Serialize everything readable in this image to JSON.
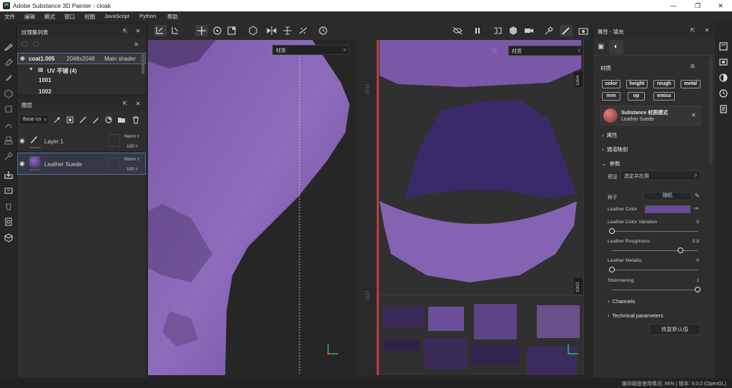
{
  "window": {
    "title": "Adobe Substance 3D Painter - cloak",
    "logo_text": "Pt"
  },
  "menu": [
    "文件",
    "编辑",
    "模式",
    "窗口",
    "视图",
    "JavaScript",
    "Python",
    "帮助"
  ],
  "texture_set_panel": {
    "title": "纹理集列表",
    "set_name": "coat1.005",
    "resolution": "2048x2048",
    "shader": "Main shader",
    "uv_group": "UV 平铺 (4)",
    "tiles": [
      "1001",
      "1002"
    ]
  },
  "layer_panel": {
    "title": "图层",
    "channel_select": "Base co",
    "layers": [
      {
        "name": "Layer 1",
        "blend": "Norm",
        "opacity": "100"
      },
      {
        "name": "Leather Suede",
        "blend": "Norm",
        "opacity": "100"
      }
    ]
  },
  "viewport": {
    "left_dropdown": "材质",
    "right_dropdown": "材质",
    "udim_labels": [
      "1004",
      "1003",
      "1014",
      "1013"
    ]
  },
  "properties_panel": {
    "title": "属性 - 填充",
    "section_material": "材质",
    "chips": [
      "color",
      "height",
      "rough",
      "metal",
      "nrm",
      "op",
      "emiss"
    ],
    "material_title": "Substance 材质模式",
    "material_name": "Leather Suede",
    "section_props": "属性",
    "section_channel_map": "通道映射",
    "section_params": "参数",
    "preset_label": "预设",
    "preset_value": "选定并应用",
    "seed_label": "种子",
    "seed_value": "随机",
    "leather_color_label": "Leather Color",
    "leather_color": "#6a4a9c",
    "params": [
      {
        "label": "Leather Color Variation",
        "value": "0",
        "fraction": 0.0
      },
      {
        "label": "Leather Roughness",
        "value": "0.8",
        "fraction": 0.8
      },
      {
        "label": "Leather Metallic",
        "value": "0",
        "fraction": 0.0
      },
      {
        "label": "Shimmering",
        "value": "1",
        "fraction": 1.0
      }
    ],
    "section_channels": "Channels",
    "section_technical": "Technical parameters",
    "reset_button": "恢复默认值"
  },
  "status": {
    "text": "缓存磁盘使用情况: 86% | 版本: 9.0.0 (OpenGL)"
  }
}
